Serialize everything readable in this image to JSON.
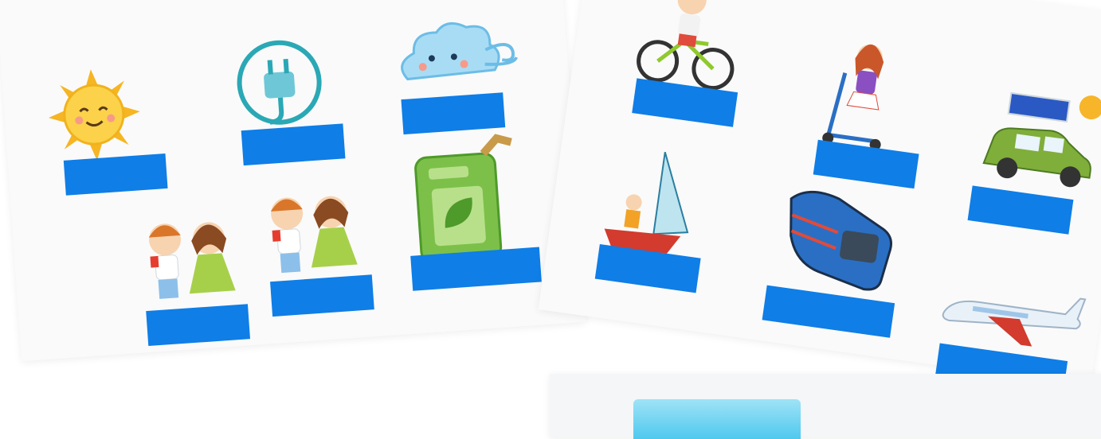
{
  "worksheet": {
    "energy_sources": [
      {
        "icon": "sun-icon",
        "label": ""
      },
      {
        "icon": "electric-plug-icon",
        "label": ""
      },
      {
        "icon": "wind-cloud-icon",
        "label": ""
      },
      {
        "icon": "children-dancing-icon",
        "label": ""
      },
      {
        "icon": "children-dancing-icon",
        "label": ""
      },
      {
        "icon": "biofuel-canister-icon",
        "label": ""
      }
    ],
    "transport": [
      {
        "icon": "boy-on-bicycle-icon",
        "label": ""
      },
      {
        "icon": "girl-on-scooter-icon",
        "label": ""
      },
      {
        "icon": "solar-car-icon",
        "label": ""
      },
      {
        "icon": "sailboat-icon",
        "label": ""
      },
      {
        "icon": "train-icon",
        "label": ""
      },
      {
        "icon": "airplane-icon",
        "label": ""
      }
    ],
    "colors": {
      "label_box": "#0f7ee6",
      "background": "#ffffff"
    }
  }
}
